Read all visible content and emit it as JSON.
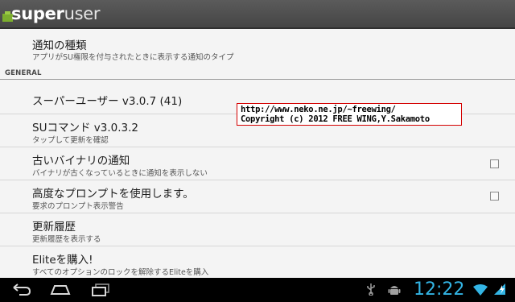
{
  "app": {
    "title_bold": "super",
    "title_light": "user",
    "icon": "superuser-app-icon"
  },
  "list": {
    "top_item": {
      "title": "通知の種類",
      "subtitle": "アプリがSU権限を付与されたときに表示する通知のタイプ"
    },
    "section_header": "GENERAL",
    "items": [
      {
        "title": "スーパーユーザー v3.0.7 (41)",
        "subtitle": ""
      },
      {
        "title": "SUコマンド v3.0.3.2",
        "subtitle": "タップして更新を確認"
      },
      {
        "title": "古いバイナリの通知",
        "subtitle": "バイナリが古くなっているときに通知を表示しない",
        "checked": false
      },
      {
        "title": "高度なプロンプトを使用します。",
        "subtitle": "要求のプロンプト表示警告",
        "checked": false
      },
      {
        "title": "更新履歴",
        "subtitle": "更新履歴を表示する"
      },
      {
        "title": "Eliteを購入!",
        "subtitle": "すべてのオプションのロックを解除するEliteを購入"
      }
    ]
  },
  "overlay": {
    "line1": "http://www.neko.ne.jp/~freewing/",
    "line2": "Copyright (c) 2012 FREE WING,Y.Sakamoto"
  },
  "navbar": {
    "buttons": [
      "back-icon",
      "home-icon",
      "recent-apps-icon"
    ],
    "clock": "12:22",
    "status_icons": [
      "usb-icon",
      "android-debug-icon",
      "wifi-icon",
      "battery-icon"
    ],
    "accent": "#33b5e5"
  }
}
